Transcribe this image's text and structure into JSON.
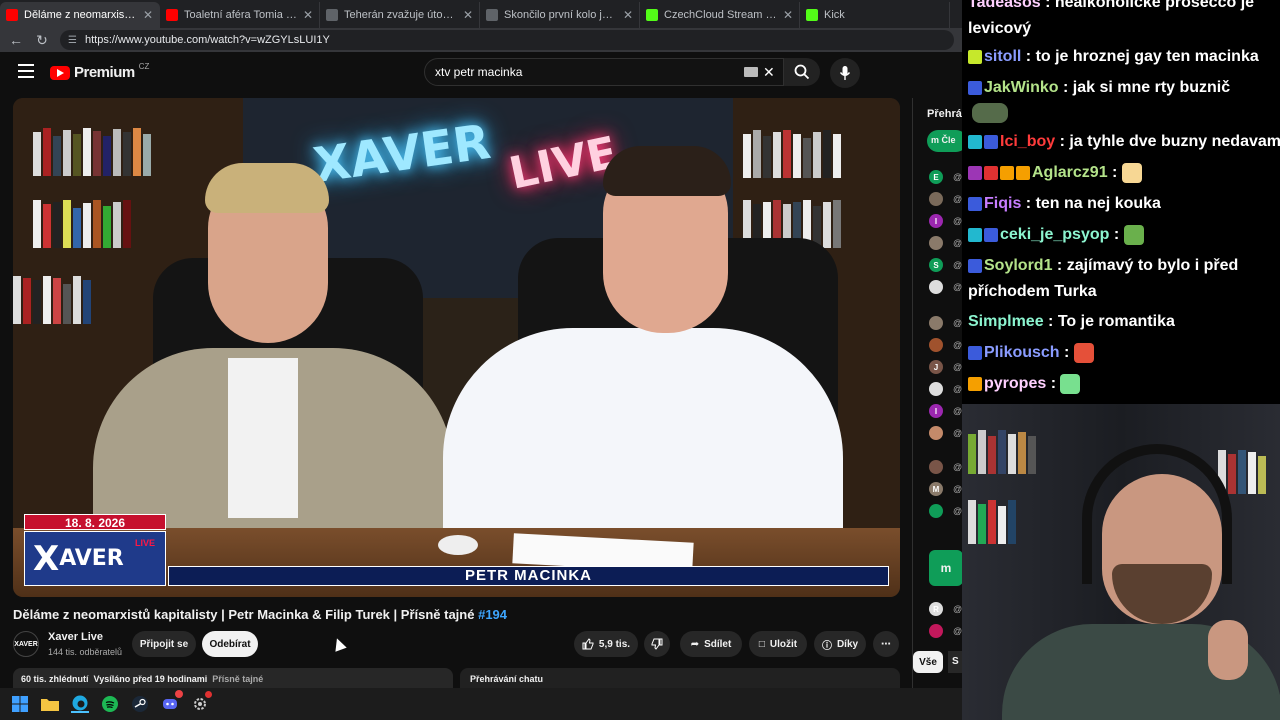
{
  "browser": {
    "tabs": [
      {
        "title": "Děláme z neomarxistů kapitali",
        "active": true,
        "favicon_color": "#ff0000"
      },
      {
        "title": "Toaletní aféra Tomia Okamury, Co",
        "active": false,
        "favicon_color": "#ff0000"
      },
      {
        "title": "Teherán zvažuje útoky na vojensk",
        "active": false,
        "favicon_color": "#5f6368"
      },
      {
        "title": "Skončilo první kolo jednání minist",
        "active": false,
        "favicon_color": "#5f6368"
      },
      {
        "title": "CzechCloud Stream - Watch Live o",
        "active": false,
        "favicon_color": "#53fc18"
      },
      {
        "title": "Kick",
        "active": false,
        "favicon_color": "#53fc18"
      }
    ],
    "url": "https://www.youtube.com/watch?v=wZGYLsLUI1Y"
  },
  "yt": {
    "logo_text": "Premium",
    "region": "CZ",
    "search_value": "xtv petr macinka"
  },
  "video": {
    "neon_left": "XAVER",
    "neon_right": "LIVE",
    "date": "18. 8. 2026",
    "logo_x": "X",
    "logo_aver": "AVER",
    "logo_live": "LIVE",
    "lower_third_name": "PETR MACINKA"
  },
  "meta": {
    "title": "Děláme z neomarxistů kapitalisty | Petr Macinka & Filip Turek | Přísně tajné",
    "title_tag": "#194",
    "channel_name": "Xaver Live",
    "channel_avatar": "XAVER",
    "subscribers": "144 tis. odběratelů",
    "join_label": "Připojit se",
    "subscribe_label": "Odebírat",
    "likes": "5,9 tis.",
    "share_label": "Sdílet",
    "save_label": "Uložit",
    "thanks_label": "Díky",
    "views": "60 tis. zhlédnutí",
    "aired": "Vysíláno před 19 hodinami",
    "desc_tag": "Přísně tajné",
    "chat_replay": "Přehrávání chatu"
  },
  "ytchat": {
    "header": "Přehráv",
    "members_label": "Čle",
    "avatars": [
      "E",
      "",
      "I",
      "",
      "S",
      "",
      "",
      "",
      "J",
      "",
      "I",
      "",
      "",
      "M",
      "",
      "R",
      "",
      "L",
      ""
    ],
    "filter_all": "Vše",
    "filter_second": "S"
  },
  "twitch_chat": [
    {
      "user": "Tadeasos",
      "text": "nealkoholické prosecco je",
      "text2": "levicový",
      "color": "#ffd0ff",
      "badges": []
    },
    {
      "user": "sitoll",
      "text": "to je hroznej gay ten macinka",
      "color": "#8a9cff",
      "badges": [
        "#c6e82b"
      ]
    },
    {
      "user": "JakWinko",
      "text": "jak si mne rty buznič",
      "color": "#b4e38a",
      "badges": [
        "#3b5bdb"
      ]
    },
    {
      "user": "Ici_boy",
      "text": "ja tyhle dve buzny nedavam",
      "color": "#ff3b3b",
      "badges": [
        "#22b8cf",
        "#3b5bdb"
      ]
    },
    {
      "user": "Aglarcz91",
      "text": "",
      "color": "#b4e38a",
      "badges": [
        "#9c36b5",
        "#e03131",
        "#f59f00",
        "#f59f00"
      ]
    },
    {
      "user": "Fiqis",
      "text": "ten na nej kouka",
      "color": "#c77dff",
      "badges": [
        "#3b5bdb"
      ]
    },
    {
      "user": "ceki_je_psyop",
      "text": "",
      "color": "#8cf5d0",
      "badges": [
        "#22b8cf",
        "#3b5bdb"
      ]
    },
    {
      "user": "Soylord1",
      "text": "zajímavý to bylo i před",
      "text2": "příchodem Turka",
      "color": "#b4e38a",
      "badges": [
        "#3b5bdb"
      ]
    },
    {
      "user": "Simplmee",
      "text": "To je romantika",
      "color": "#8cf5d0",
      "badges": []
    },
    {
      "user": "Plikousch",
      "text": "",
      "color": "#8a9cff",
      "badges": [
        "#3b5bdb"
      ]
    },
    {
      "user": "pyropes",
      "text": "",
      "color": "#ffd0ff",
      "badges": [
        "#f59f00"
      ]
    }
  ]
}
